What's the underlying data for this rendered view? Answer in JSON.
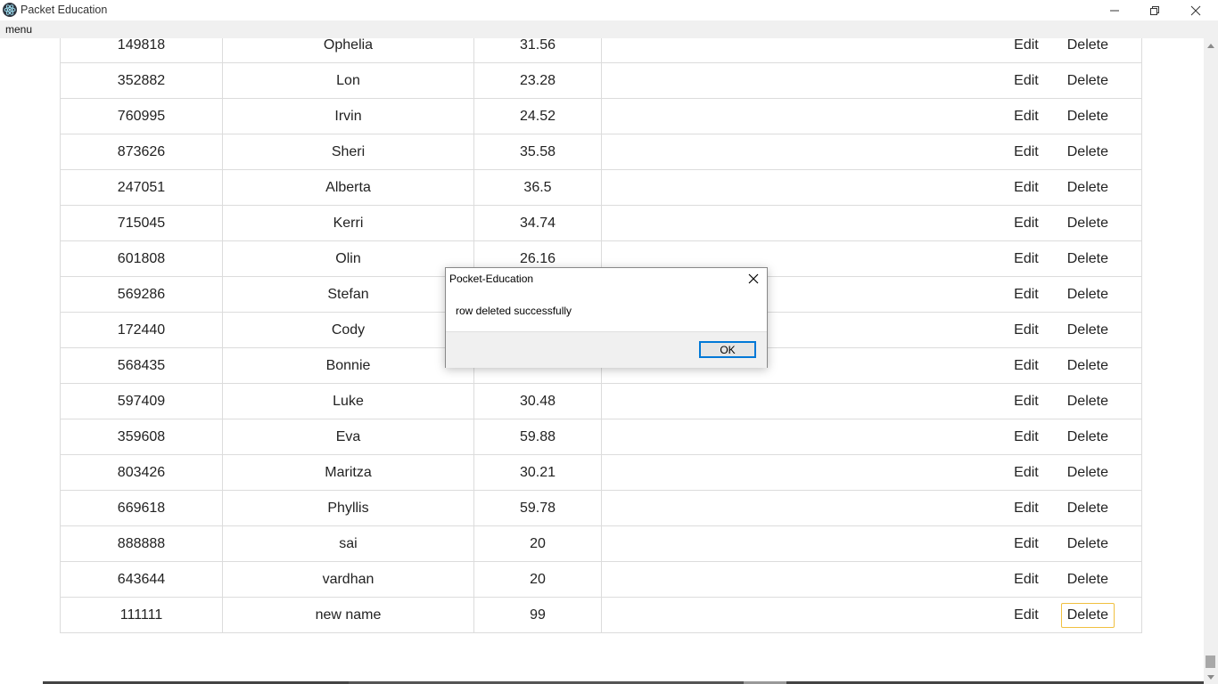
{
  "window": {
    "title": "Packet Education",
    "app_icon": "electron-atom-icon"
  },
  "menubar": {
    "menu_label": "menu"
  },
  "table": {
    "edit_label": "Edit",
    "delete_label": "Delete",
    "rows": [
      {
        "id": "149818",
        "name": "Ophelia",
        "value": "31.56"
      },
      {
        "id": "352882",
        "name": "Lon",
        "value": "23.28"
      },
      {
        "id": "760995",
        "name": "Irvin",
        "value": "24.52"
      },
      {
        "id": "873626",
        "name": "Sheri",
        "value": "35.58"
      },
      {
        "id": "247051",
        "name": "Alberta",
        "value": "36.5"
      },
      {
        "id": "715045",
        "name": "Kerri",
        "value": "34.74"
      },
      {
        "id": "601808",
        "name": "Olin",
        "value": "26.16"
      },
      {
        "id": "569286",
        "name": "Stefan",
        "value": ""
      },
      {
        "id": "172440",
        "name": "Cody",
        "value": ""
      },
      {
        "id": "568435",
        "name": "Bonnie",
        "value": ""
      },
      {
        "id": "597409",
        "name": "Luke",
        "value": "30.48"
      },
      {
        "id": "359608",
        "name": "Eva",
        "value": "59.88"
      },
      {
        "id": "803426",
        "name": "Maritza",
        "value": "30.21"
      },
      {
        "id": "669618",
        "name": "Phyllis",
        "value": "59.78"
      },
      {
        "id": "888888",
        "name": "sai",
        "value": "20"
      },
      {
        "id": "643644",
        "name": "vardhan",
        "value": "20"
      },
      {
        "id": "111111",
        "name": "new name",
        "value": "99"
      }
    ],
    "focused_delete_row_index": 16
  },
  "dialog": {
    "title": "Pocket-Education",
    "message": "row deleted successfully",
    "ok_label": "OK",
    "ok_border_color": "#0078d7"
  },
  "scrollbar": {
    "position_fraction": 0.98
  }
}
